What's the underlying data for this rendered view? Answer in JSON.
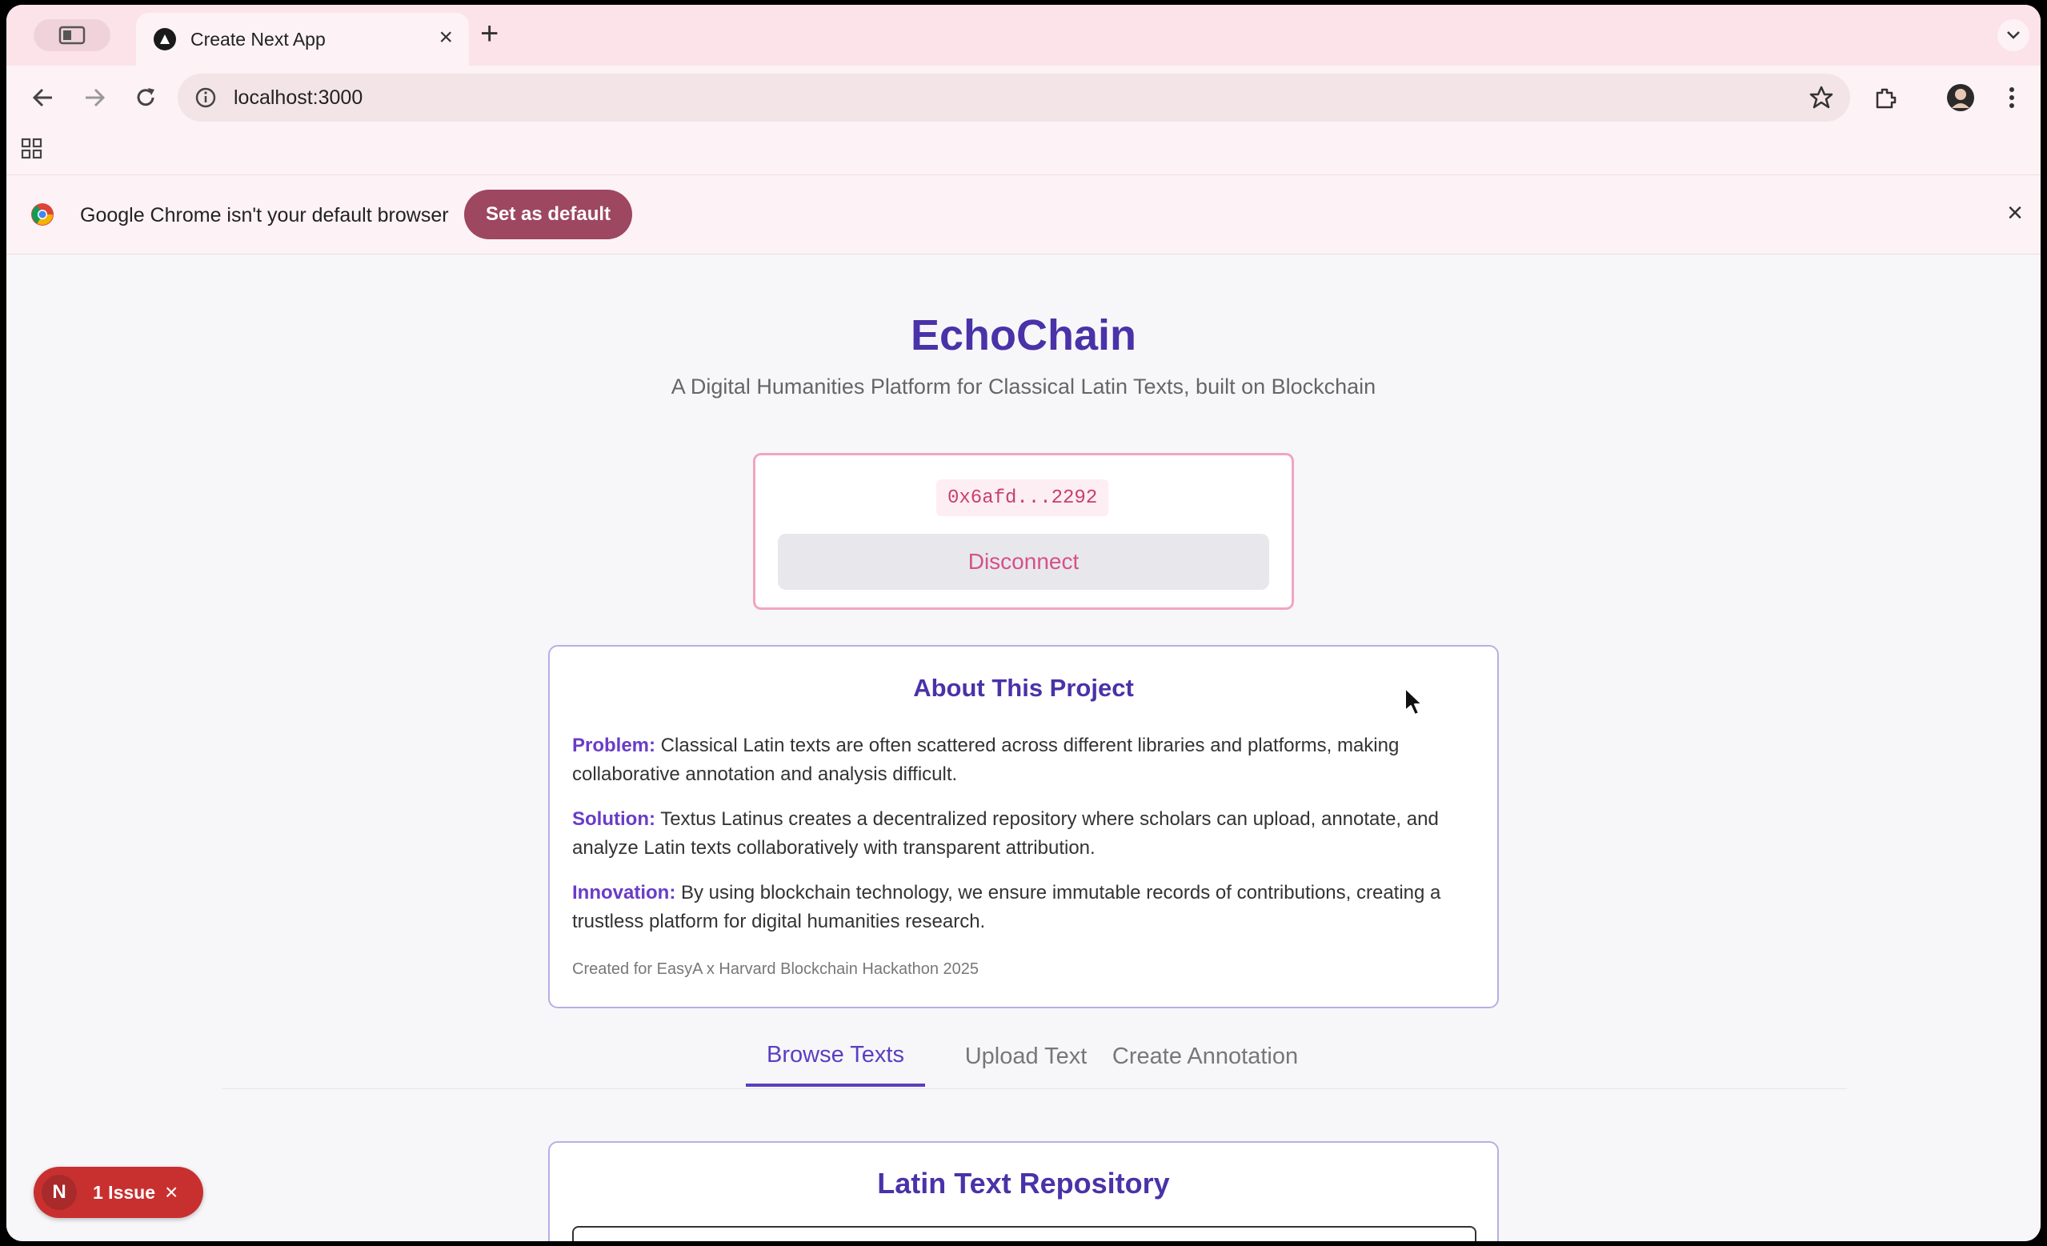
{
  "browser": {
    "tab_title": "Create Next App",
    "url": "localhost:3000",
    "infobar_text": "Google Chrome isn't your default browser",
    "set_default_label": "Set as default"
  },
  "app": {
    "title": "EchoChain",
    "subtitle": "A Digital Humanities Platform for Classical Latin Texts, built on Blockchain"
  },
  "wallet": {
    "address": "0x6afd...2292",
    "disconnect_label": "Disconnect"
  },
  "about": {
    "title": "About This Project",
    "problem_label": "Problem:",
    "problem_text": " Classical Latin texts are often scattered across different libraries and platforms, making collaborative annotation and analysis difficult.",
    "solution_label": "Solution:",
    "solution_text": " Textus Latinus creates a decentralized repository where scholars can upload, annotate, and analyze Latin texts collaboratively with transparent attribution.",
    "innovation_label": "Innovation:",
    "innovation_text": " By using blockchain technology, we ensure immutable records of contributions, creating a trustless platform for digital humanities research.",
    "footer": "Created for EasyA x Harvard Blockchain Hackathon 2025"
  },
  "tabs": [
    {
      "label": "Browse Texts",
      "active": true
    },
    {
      "label": "Upload Text",
      "active": false
    },
    {
      "label": "Create Annotation",
      "active": false
    }
  ],
  "repository": {
    "title": "Latin Text Repository"
  },
  "dev_badge": {
    "logo": "N",
    "label": "1 Issue"
  },
  "colors": {
    "accent": "#4a32a8",
    "pink": "#d6508a",
    "infobar_button": "#9e4760",
    "issue_badge": "#c8302f"
  }
}
